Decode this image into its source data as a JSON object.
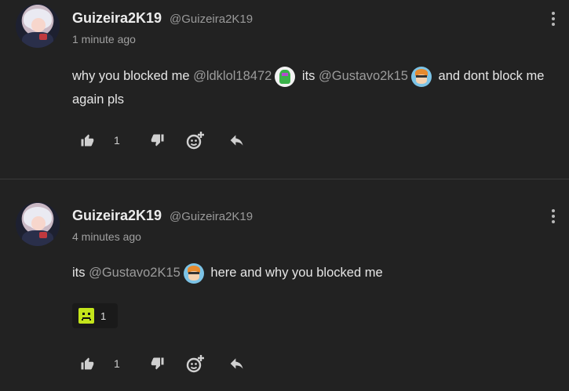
{
  "posts": [
    {
      "username": "Guizeira2K19",
      "handle": "@Guizeira2K19",
      "time": "1 minute ago",
      "body": {
        "t1": "why you blocked me ",
        "m1": "@ldklol18472",
        "t2": " its ",
        "m2": "@Gustavo2k15",
        "t3": " and dont block me again pls"
      },
      "likes": "1"
    },
    {
      "username": "Guizeira2K19",
      "handle": "@Guizeira2K19",
      "time": "4 minutes ago",
      "body": {
        "t1": "its ",
        "m1": "@Gustavo2K15",
        "t2": " here  and why you blocked me"
      },
      "reaction": {
        "emoji": "green-square-face-emoji",
        "count": "1"
      },
      "likes": "1"
    }
  ],
  "icons": {
    "like": "thumbs-up-icon",
    "dislike": "thumbs-down-icon",
    "react": "add-reaction-icon",
    "reply": "reply-icon",
    "more": "more-vertical-icon"
  },
  "colors": {
    "background": "#222222",
    "mention": "#9b9b9b",
    "reaction_emoji": "#c4e51b"
  }
}
